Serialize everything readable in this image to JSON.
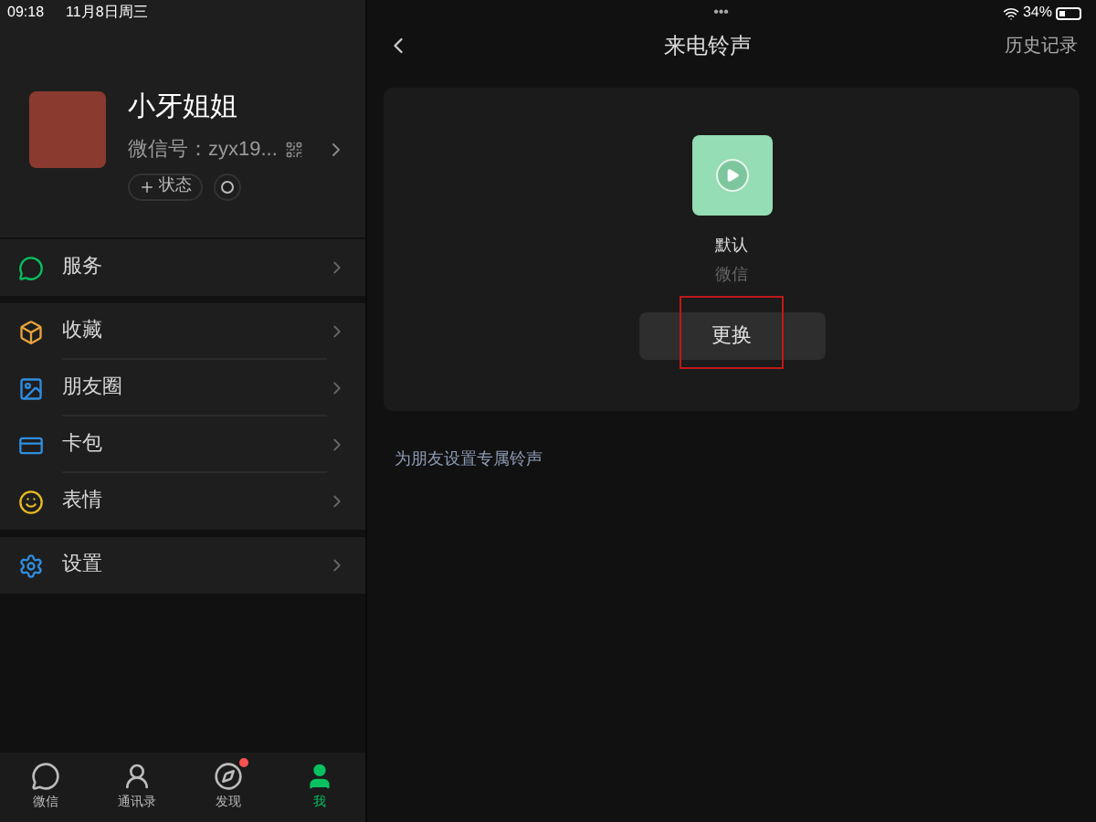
{
  "status_bar": {
    "time": "09:18",
    "date": "11月8日周三",
    "dots": "•••",
    "battery": "34%",
    "battery_meter": {
      "level": 0.34
    }
  },
  "profile": {
    "name": "小牙姐姐",
    "wechat_id": "微信号：zyx19...",
    "status_button": "状态"
  },
  "menu_groups": [
    [
      {
        "label": "服务"
      }
    ],
    [
      {
        "label": "收藏"
      },
      {
        "label": "朋友圈"
      },
      {
        "label": "卡包"
      },
      {
        "label": "表情"
      }
    ],
    [
      {
        "label": "设置"
      }
    ]
  ],
  "tab_bar": [
    {
      "label": "微信",
      "selected": false,
      "badge": false
    },
    {
      "label": "通讯录",
      "selected": false,
      "badge": false
    },
    {
      "label": "发现",
      "selected": false,
      "badge": true
    },
    {
      "label": "我",
      "selected": true,
      "badge": false
    }
  ],
  "nav": {
    "title": "来电铃声",
    "action": "历史记录"
  },
  "ringtone": {
    "name": "默认",
    "source": "微信",
    "button": "更换",
    "highlighted": true
  },
  "friend_link": "为朋友设置专属铃声"
}
